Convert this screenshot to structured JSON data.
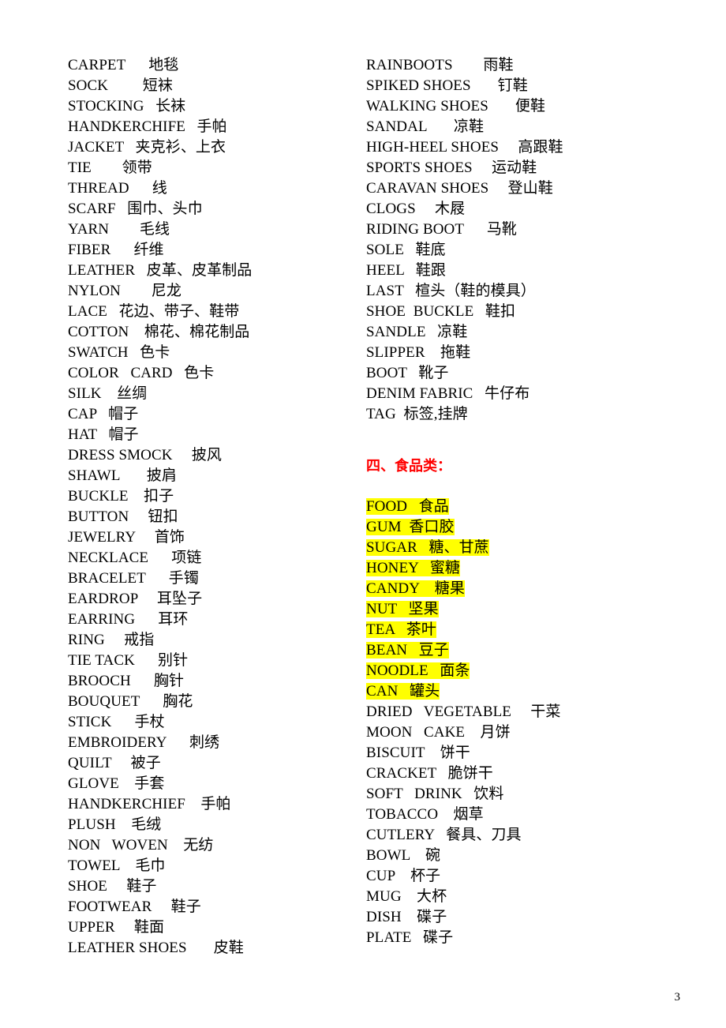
{
  "document": {
    "page_number": "3",
    "highlight_color": "#ffff00",
    "heading_color": "#ff0000"
  },
  "left_column": {
    "entries": [
      "CARPET      地毯",
      "SOCK         短袜",
      "STOCKING   长袜",
      "HANDKERCHIFE   手帕",
      "JACKET   夹克衫、上衣",
      "TIE        领带",
      "THREAD      线",
      "SCARF   围巾、头巾",
      "YARN        毛线",
      "FIBER      纤维",
      "LEATHER   皮革、皮革制品",
      "NYLON        尼龙",
      "LACE   花边、带子、鞋带",
      "COTTON    棉花、棉花制品",
      "SWATCH   色卡",
      "COLOR   CARD   色卡",
      "SILK    丝绸",
      "CAP   帽子",
      "HAT   帽子",
      "DRESS SMOCK     披风",
      "SHAWL       披肩",
      "BUCKLE    扣子",
      "BUTTON     钮扣",
      "JEWELRY     首饰",
      "NECKLACE      项链",
      "BRACELET      手镯",
      "EARDROP     耳坠子",
      "EARRING      耳环",
      "RING     戒指",
      "TIE TACK      别针",
      "BROOCH      胸针",
      "BOUQUET      胸花",
      "STICK      手杖",
      "EMBROIDERY      刺绣",
      "QUILT     被子",
      "GLOVE    手套",
      "HANDKERCHIEF    手帕",
      "PLUSH    毛绒",
      "NON   WOVEN    无纺",
      "TOWEL    毛巾",
      "SHOE     鞋子",
      "FOOTWEAR     鞋子",
      "UPPER     鞋面",
      "LEATHER SHOES       皮鞋"
    ]
  },
  "right_column": {
    "shoe_entries": [
      "RAINBOOTS        雨鞋",
      "SPIKED SHOES       钉鞋",
      "WALKING SHOES       便鞋",
      "SANDAL       凉鞋",
      "HIGH-HEEL SHOES     高跟鞋",
      "SPORTS SHOES     运动鞋",
      "CARAVAN SHOES     登山鞋",
      "CLOGS     木屐",
      "RIDING BOOT      马靴",
      "SOLE   鞋底",
      "HEEL   鞋跟",
      "LAST   楦头（鞋的模具）",
      "SHOE  BUCKLE   鞋扣",
      "SANDLE   凉鞋",
      "SLIPPER    拖鞋",
      "BOOT   靴子",
      "DENIM FABRIC   牛仔布",
      "TAG  标签,挂牌"
    ],
    "section_heading": "四、食品类：",
    "food_entries_highlighted": [
      "FOOD   食品",
      "GUM  香口胶",
      "SUGAR   糖、甘蔗",
      "HONEY   蜜糖",
      "CANDY    糖果",
      "NUT   坚果",
      "TEA   茶叶",
      "BEAN   豆子",
      "NOODLE   面条",
      "CAN   罐头"
    ],
    "food_entries_plain": [
      "DRIED   VEGETABLE     干菜",
      "MOON   CAKE    月饼",
      "BISCUIT    饼干",
      "CRACKET   脆饼干",
      "SOFT   DRINK   饮料",
      "TOBACCO    烟草",
      "CUTLERY   餐具、刀具",
      "BOWL    碗",
      "CUP    杯子",
      "MUG    大杯",
      "DISH    碟子",
      "PLATE   碟子"
    ]
  }
}
